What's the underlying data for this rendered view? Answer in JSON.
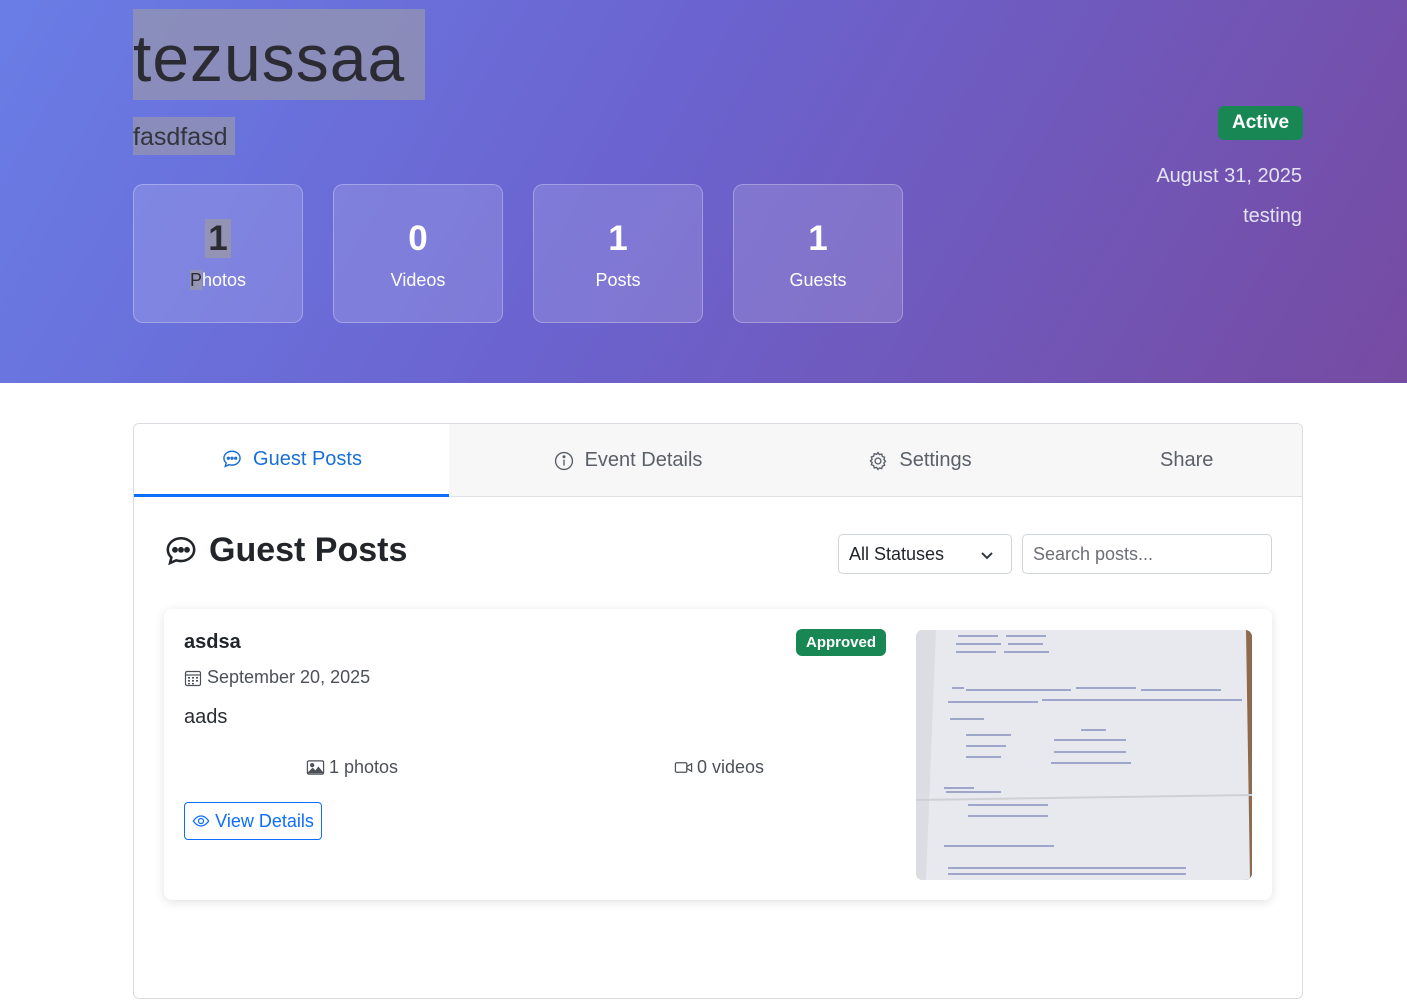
{
  "event": {
    "title": "tezussaa",
    "subtitle": "fasdfasd",
    "status": "Active",
    "date": "August 31, 2025",
    "location": "testing",
    "stats": [
      {
        "value": "1",
        "label": "Photos"
      },
      {
        "value": "0",
        "label": "Videos"
      },
      {
        "value": "1",
        "label": "Posts"
      },
      {
        "value": "1",
        "label": "Guests"
      }
    ]
  },
  "tabs": [
    {
      "label": "Guest Posts",
      "icon": "chat-dots-icon"
    },
    {
      "label": "Event Details",
      "icon": "info-circle-icon"
    },
    {
      "label": "Settings",
      "icon": "gear-icon"
    },
    {
      "label": "Share"
    }
  ],
  "section": {
    "title": "Guest Posts",
    "status_filter": "All Statuses",
    "search_placeholder": "Search posts..."
  },
  "posts": [
    {
      "name": "asdsa",
      "status": "Approved",
      "date": "September 20, 2025",
      "text": "aads",
      "photos": "1 photos",
      "videos": "0 videos",
      "action": "View Details",
      "thumbnail": "handwritten-note-photo"
    }
  ],
  "colors": {
    "accent": "#0d6efd",
    "success": "#198754",
    "hero_start": "#6a7de6",
    "hero_end": "#764ba2"
  }
}
